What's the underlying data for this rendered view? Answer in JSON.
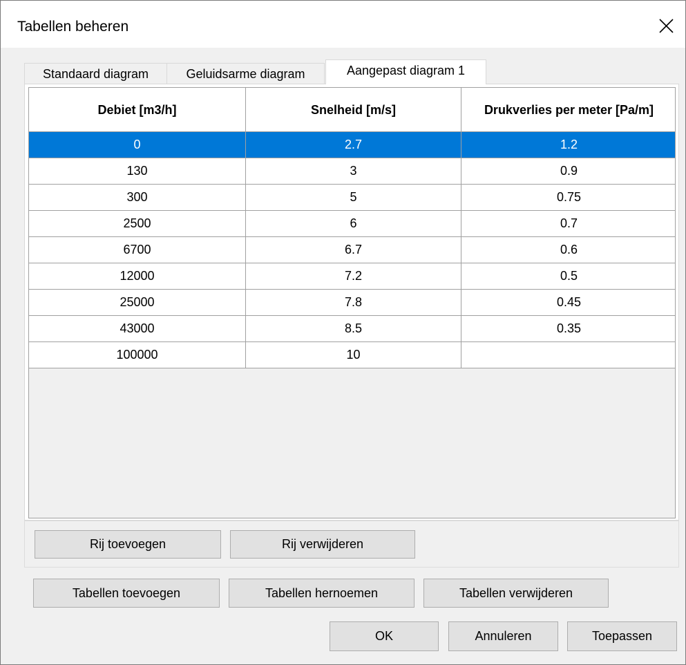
{
  "window": {
    "title": "Tabellen beheren"
  },
  "tabs": [
    {
      "label": "Standaard diagram",
      "active": false
    },
    {
      "label": "Geluidsarme diagram",
      "active": false
    },
    {
      "label": "Aangepast diagram 1",
      "active": true
    }
  ],
  "table": {
    "columns": [
      "Debiet [m3/h]",
      "Snelheid [m/s]",
      "Drukverlies per meter [Pa/m]"
    ],
    "selected_row": 0,
    "rows": [
      [
        "0",
        "2.7",
        "1.2"
      ],
      [
        "130",
        "3",
        "0.9"
      ],
      [
        "300",
        "5",
        "0.75"
      ],
      [
        "2500",
        "6",
        "0.7"
      ],
      [
        "6700",
        "6.7",
        "0.6"
      ],
      [
        "12000",
        "7.2",
        "0.5"
      ],
      [
        "25000",
        "7.8",
        "0.45"
      ],
      [
        "43000",
        "8.5",
        "0.35"
      ],
      [
        "100000",
        "10",
        ""
      ]
    ]
  },
  "row_buttons": {
    "add": "Rij toevoegen",
    "remove": "Rij verwijderen"
  },
  "table_buttons": {
    "add": "Tabellen toevoegen",
    "rename": "Tabellen hernoemen",
    "remove": "Tabellen verwijderen"
  },
  "dialog_buttons": {
    "ok": "OK",
    "cancel": "Annuleren",
    "apply": "Toepassen"
  },
  "colors": {
    "selection": "#0078d7",
    "dialog_bg": "#f0f0f0",
    "button_bg": "#e1e1e1"
  }
}
